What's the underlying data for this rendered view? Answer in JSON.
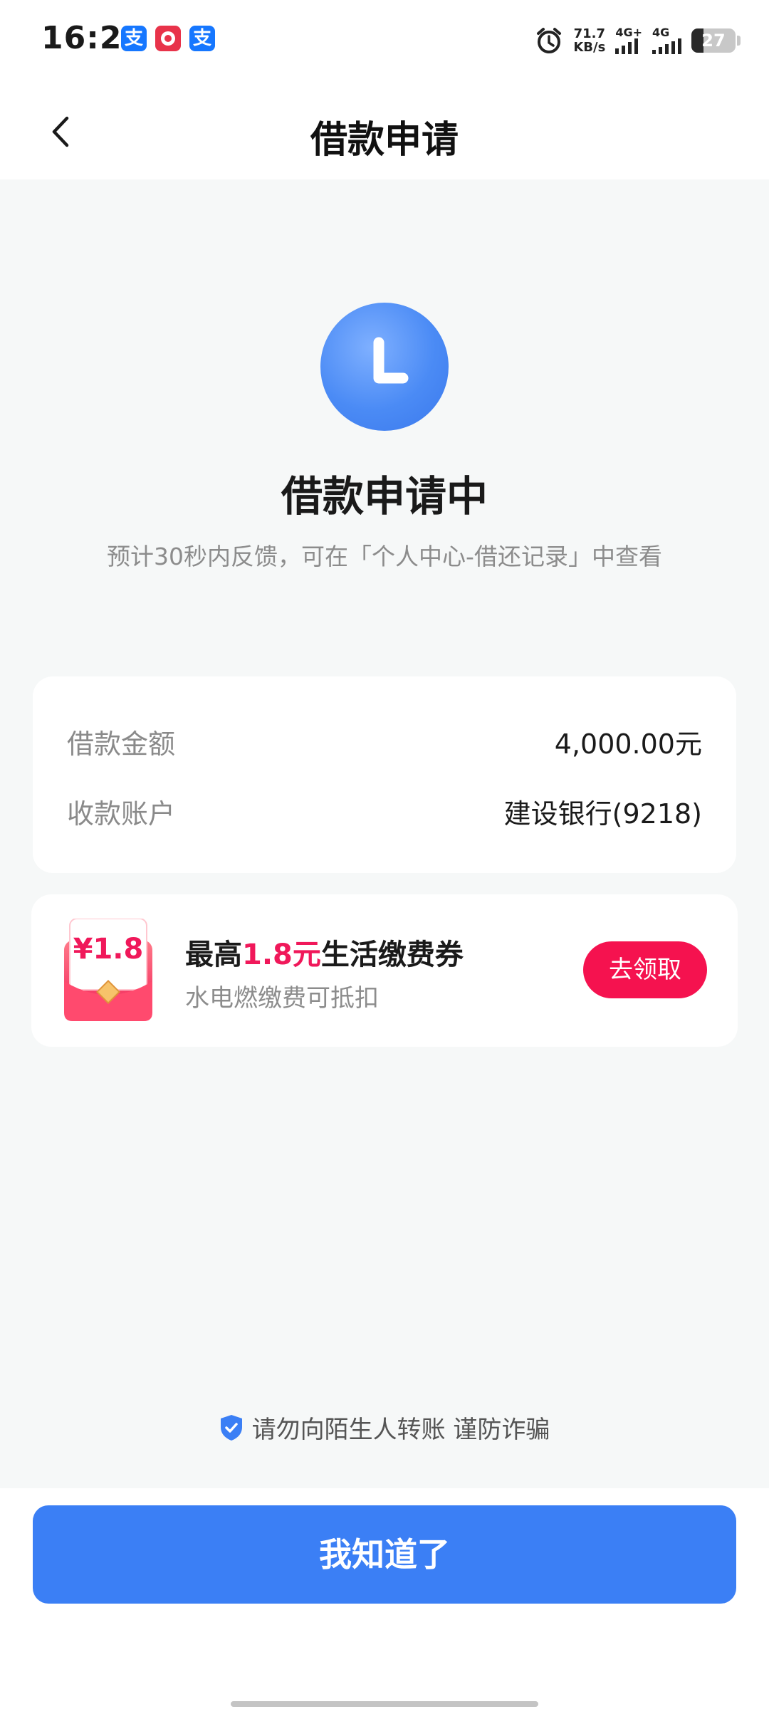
{
  "status_bar": {
    "time": "16:21",
    "app_icons": [
      "支",
      "支"
    ],
    "net_speed_value": "71.7",
    "net_speed_unit": "KB/s",
    "network_1": "4G+",
    "network_2": "4G",
    "battery": "27",
    "battery_level_percent": 27
  },
  "nav": {
    "title": "借款申请",
    "back_icon": "chevron-left-icon"
  },
  "status": {
    "icon": "clock-icon",
    "title": "借款申请中",
    "subtitle": "预计30秒内反馈，可在「个人中心-借还记录」中查看"
  },
  "details": {
    "rows": [
      {
        "label": "借款金额",
        "value": "4,000.00元"
      },
      {
        "label": "收款账户",
        "value": "建设银行(9218)"
      }
    ]
  },
  "coupon": {
    "badge": "¥1.8",
    "title_prefix": "最高",
    "title_highlight": "1.8元",
    "title_suffix": "生活缴费券",
    "subtitle": "水电燃缴费可抵扣",
    "button": "去领取",
    "highlight_color": "#f0185a"
  },
  "notice": {
    "icon": "shield-check-icon",
    "text": "请勿向陌生人转账 谨防诈骗"
  },
  "primary_button": {
    "label": "我知道了",
    "color": "#3b7ff5"
  }
}
